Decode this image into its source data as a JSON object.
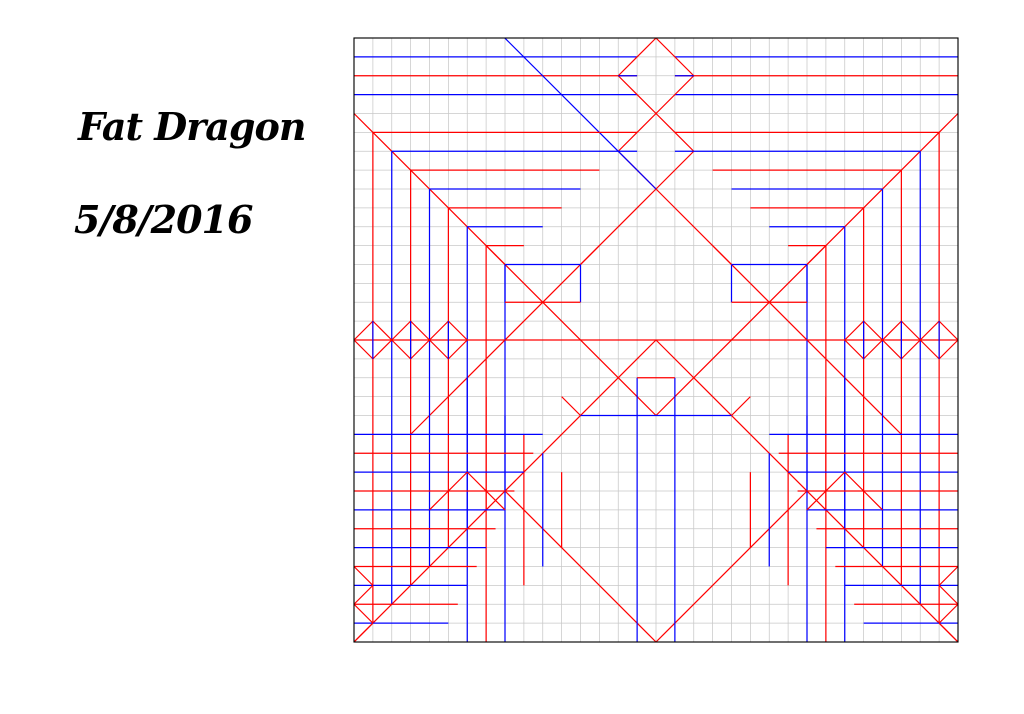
{
  "title": "Fat Dragon",
  "date": "5/8/2016",
  "crease_pattern": {
    "grid_divisions": 32,
    "colors": {
      "grid": "#c8c8c8",
      "border": "#000000",
      "mountain": "#ff0000",
      "valley": "#0000ff"
    }
  }
}
